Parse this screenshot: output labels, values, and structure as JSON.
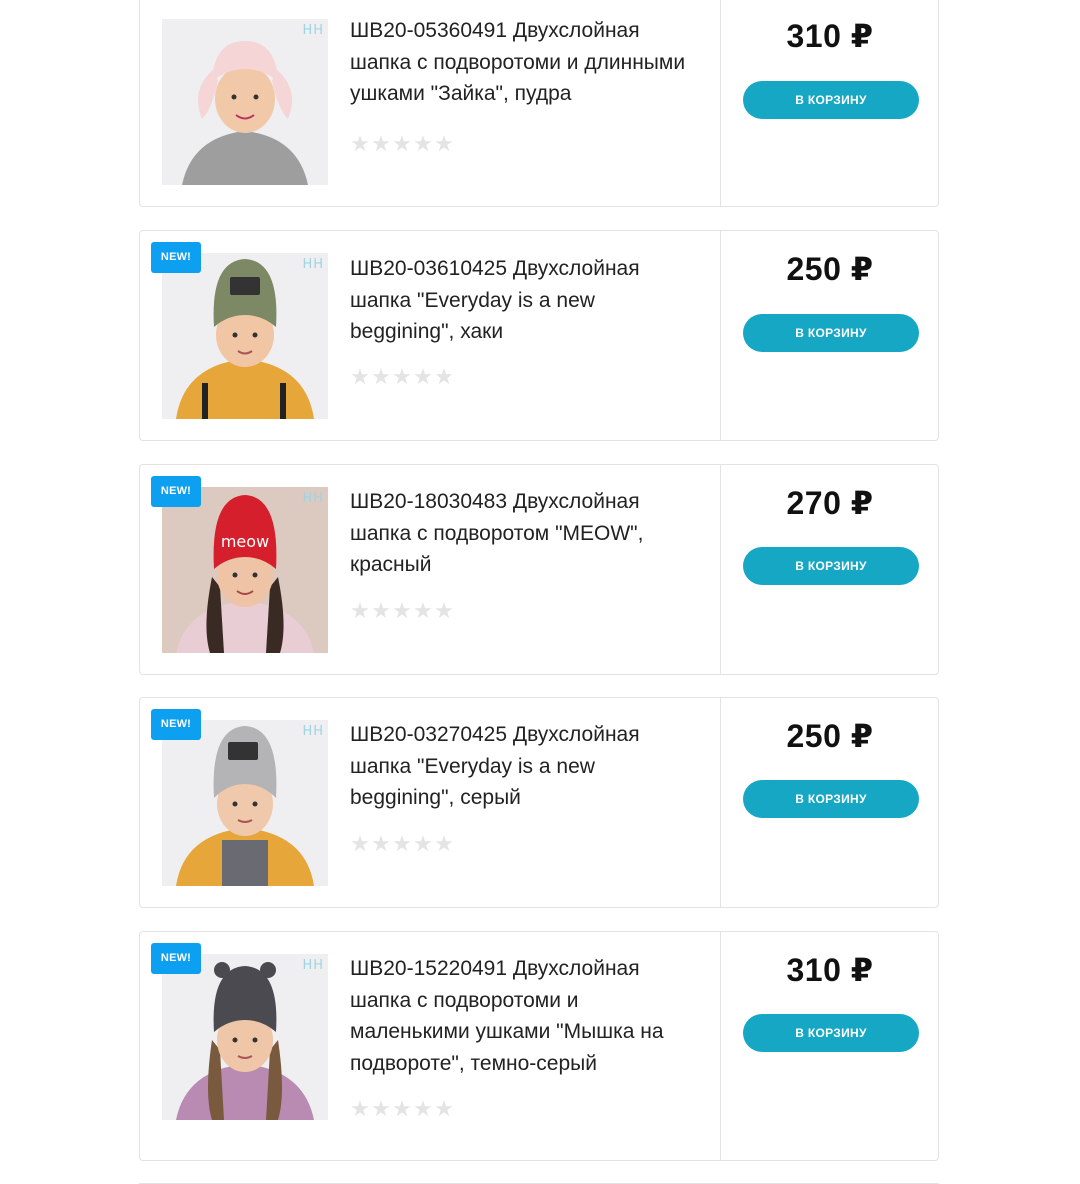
{
  "currency": "₽",
  "cart_label": "в корзину",
  "new_label": "NEW!",
  "brand_mark": "HH",
  "products": [
    {
      "title": "ШВ20-05360491 Двухслойная шапка с подворотоми и длинными ушками \"Зайка\", пудра",
      "price": "310 ₽",
      "is_new": false,
      "rating": 0,
      "hat_color": "#f5d5d5",
      "hat_style": "bunny",
      "top_color": "#9e9e9e"
    },
    {
      "title": "ШВ20-03610425 Двухслойная шапка \"Everyday is a new beggining\", хаки",
      "price": "250 ₽",
      "is_new": true,
      "rating": 0,
      "hat_color": "#7d8864",
      "hat_style": "beanie",
      "top_color": "#e6a63a"
    },
    {
      "title": "ШВ20-18030483 Двухслойная шапка с подворотом \"MEOW\", красный",
      "price": "270 ₽",
      "is_new": true,
      "rating": 0,
      "hat_color": "#d61f2c",
      "hat_style": "beanie",
      "top_color": "#e9cdd4"
    },
    {
      "title": "ШВ20-03270425 Двухслойная шапка \"Everyday is a new beggining\", серый",
      "price": "250 ₽",
      "is_new": true,
      "rating": 0,
      "hat_color": "#b4b4b6",
      "hat_style": "beanie",
      "top_color": "#e6a63a"
    },
    {
      "title": "ШВ20-15220491 Двухслойная шапка с подворотоми и маленькими ушками \"Мышка на подвороте\", темно-серый",
      "price": "310 ₽",
      "is_new": true,
      "rating": 0,
      "hat_color": "#4b4a50",
      "hat_style": "mouse",
      "top_color": "#b98bb3"
    }
  ]
}
